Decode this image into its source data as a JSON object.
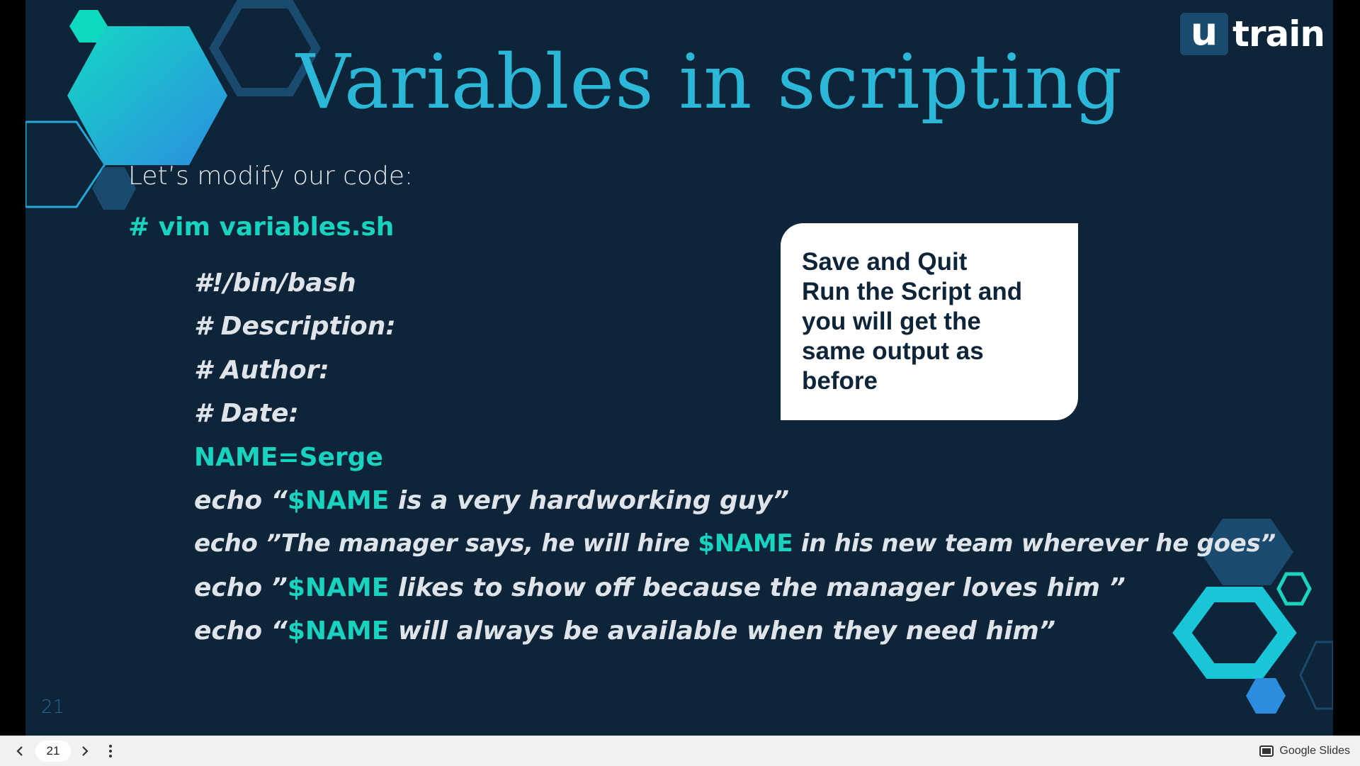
{
  "slide": {
    "title": "Variables in scripting",
    "logo": {
      "box": "u",
      "word": "train"
    },
    "intro": "Let’s modify our code:",
    "vim_command": "# vim variables.sh",
    "code": {
      "shebang": "#!/bin/bash",
      "description": "# Description:",
      "author": "# Author:",
      "date": "# Date:",
      "assignment": "NAME=Serge",
      "var": "$NAME",
      "echo1": {
        "a": "echo “",
        "b": " is a very hardworking guy”"
      },
      "echo2": {
        "a": "echo ”The manager says, he will hire ",
        "b": " in his new team wherever he goes”"
      },
      "echo3": {
        "a": "echo ”",
        "b": " likes to show off because the manager loves him ”"
      },
      "echo4": {
        "a": "echo “",
        "b": " will always be available when they need him”"
      }
    },
    "callout": [
      "Save and Quit",
      "Run the Script and",
      "you will get the",
      "same output as",
      "before"
    ],
    "slide_number": "21"
  },
  "toolbar": {
    "page": "21",
    "app_name": "Google Slides"
  },
  "colors": {
    "background": "#0e2438",
    "accent_teal": "#18d3bf",
    "title_blue": "#2bb8d8",
    "text": "#dfe4ea"
  }
}
